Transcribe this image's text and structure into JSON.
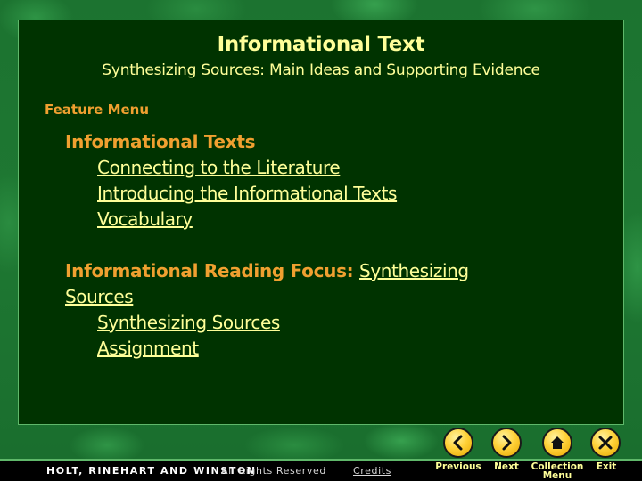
{
  "page": {
    "title": "Informational Text",
    "subtitle": "Synthesizing Sources: Main Ideas and Supporting Evidence"
  },
  "feature_menu": {
    "label": "Feature Menu",
    "sections": [
      {
        "heading": "Informational Texts",
        "heading_link": null,
        "items": [
          "Connecting to the Literature",
          "Introducing the Informational Texts",
          "Vocabulary"
        ]
      },
      {
        "heading": "Informational Reading Focus:",
        "heading_link": "Synthesizing",
        "heading_link_cont": "Sources",
        "items": [
          "Synthesizing Sources",
          "Assignment"
        ]
      }
    ]
  },
  "nav": {
    "previous": {
      "label": "Previous",
      "icon": "chevron-left-icon"
    },
    "next": {
      "label": "Next",
      "icon": "chevron-right-icon"
    },
    "collection_menu": {
      "label_line1": "Collection",
      "label_line2": "Menu",
      "icon": "home-icon"
    },
    "exit": {
      "label": "Exit",
      "icon": "close-icon"
    }
  },
  "footer": {
    "brand": "HOLT, RINEHART AND WINSTON",
    "rights": "All Rights Reserved",
    "credits": "Credits"
  },
  "colors": {
    "panel_bg": "#003300",
    "title_text": "#ffff99",
    "accent_orange": "#f0a030",
    "button_gold": "#ffd23a"
  }
}
